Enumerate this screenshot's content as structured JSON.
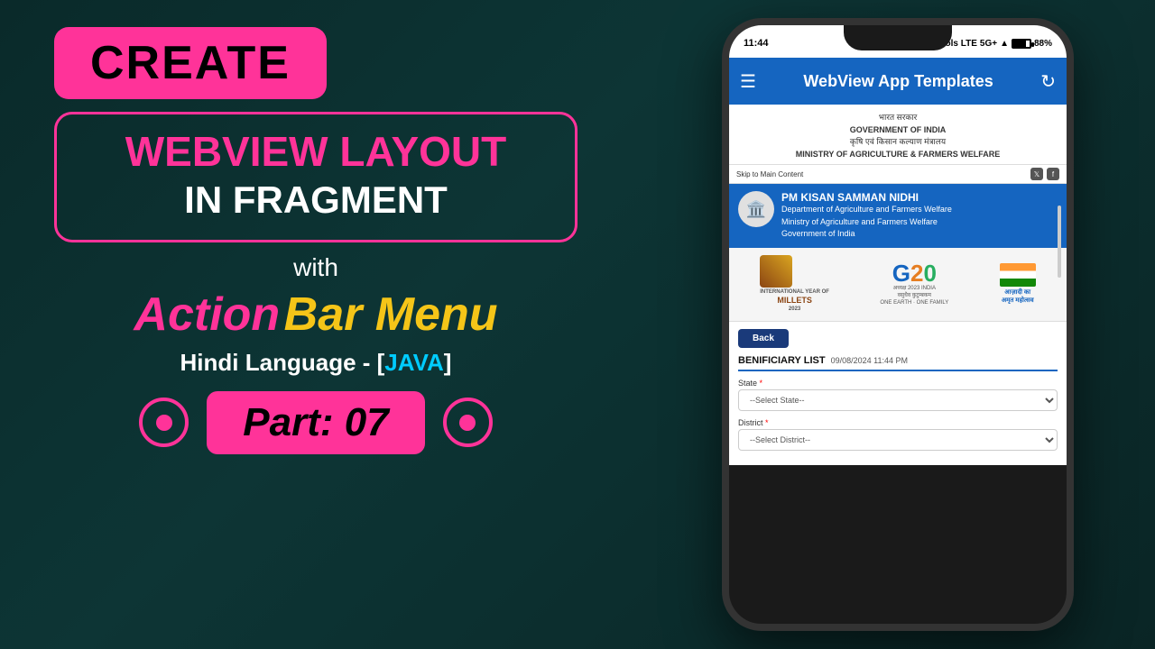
{
  "left": {
    "create_label": "CREATE",
    "webview_layout": "WEBVIEW LAYOUT",
    "in_fragment": "IN FRAGMENT",
    "with_label": "with",
    "action_text": "Action  Bar Menu",
    "action_pink": "Action",
    "action_yellow": "Bar Menu",
    "hindi_java": "Hindi Language - [JAVA]",
    "java_label": "JAVA",
    "part_label": "Part: 07"
  },
  "phone": {
    "status_time": "11:44",
    "status_signal": "5G+",
    "status_battery": "88%",
    "app_title": "WebView App Templates",
    "gov_hindi_line1": "भारत सरकार",
    "gov_line2": "GOVERNMENT OF INDIA",
    "gov_hindi_line3": "कृषि एवं किसान कल्याण मंत्रालय",
    "gov_line4": "MINISTRY OF AGRICULTURE & FARMERS WELFARE",
    "skip_text": "Skip to Main Content",
    "pm_kisan_title": "PM KISAN SAMMAN NIDHI",
    "pm_dept1": "Department of Agriculture and Farmers Welfare",
    "pm_dept2": "Ministry of Agriculture and Farmers Welfare",
    "pm_dept3": "Government of India",
    "millets_label": "INTERNATIONAL YEAR OF\nMILLETS\n2023",
    "g20_label": "G20",
    "g20_sub": "अध्यक्ष 2023 INDIA\nवसुधैव कुटुम्बकम\nONE EARTH · ONE FAMILY · ONE FUTURE",
    "azadi_label": "आज़ादी का\nअमृत महोत्सव",
    "back_btn": "Back",
    "benef_title": "BENIFICIARY LIST",
    "benef_date": "09/08/2024 11:44 PM",
    "state_label": "State",
    "state_placeholder": "--Select State--",
    "district_label": "District",
    "district_placeholder": "--Select District--"
  },
  "colors": {
    "pink": "#ff3399",
    "yellow": "#f5c518",
    "cyan": "#00ccff",
    "blue": "#1565C0",
    "dark_bg": "#0a2a2a"
  }
}
